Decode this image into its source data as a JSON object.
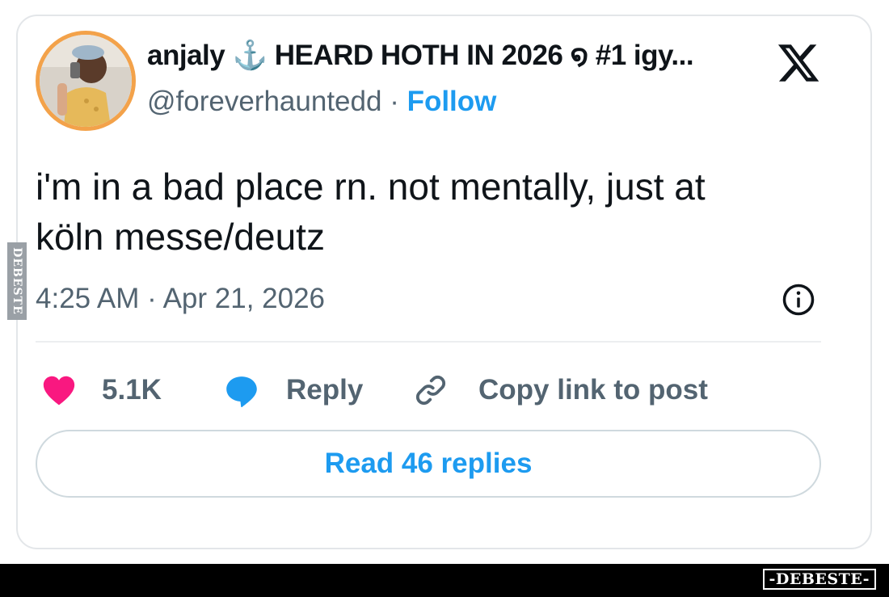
{
  "tweet": {
    "display_name": "anjaly ⚓ HEARD HOTH IN 2026 ໑ #1 igy...",
    "handle": "@foreverhauntedd",
    "separator": "·",
    "follow_label": "Follow",
    "text_lines": [
      "i'm in a bad place rn. not mentally, just at",
      "köln messe/deutz"
    ],
    "timestamp": "4:25 AM · Apr 21, 2026",
    "like_count": "5.1K",
    "reply_label": "Reply",
    "copy_link_label": "Copy link to post",
    "read_replies_label": "Read 46 replies"
  },
  "icons": {
    "platform": "x-logo-icon",
    "info": "info-icon",
    "like": "heart-icon",
    "reply": "speech-bubble-icon",
    "copy": "link-icon"
  },
  "colors": {
    "accent": "#1d9bf0",
    "like": "#f91880",
    "muted_text": "#536471",
    "text": "#0f1419",
    "border": "#cfd9de",
    "avatar_ring": "#f3a24a"
  },
  "watermark": {
    "side": "DEBESTE",
    "footer": "-DEBESTE-"
  }
}
